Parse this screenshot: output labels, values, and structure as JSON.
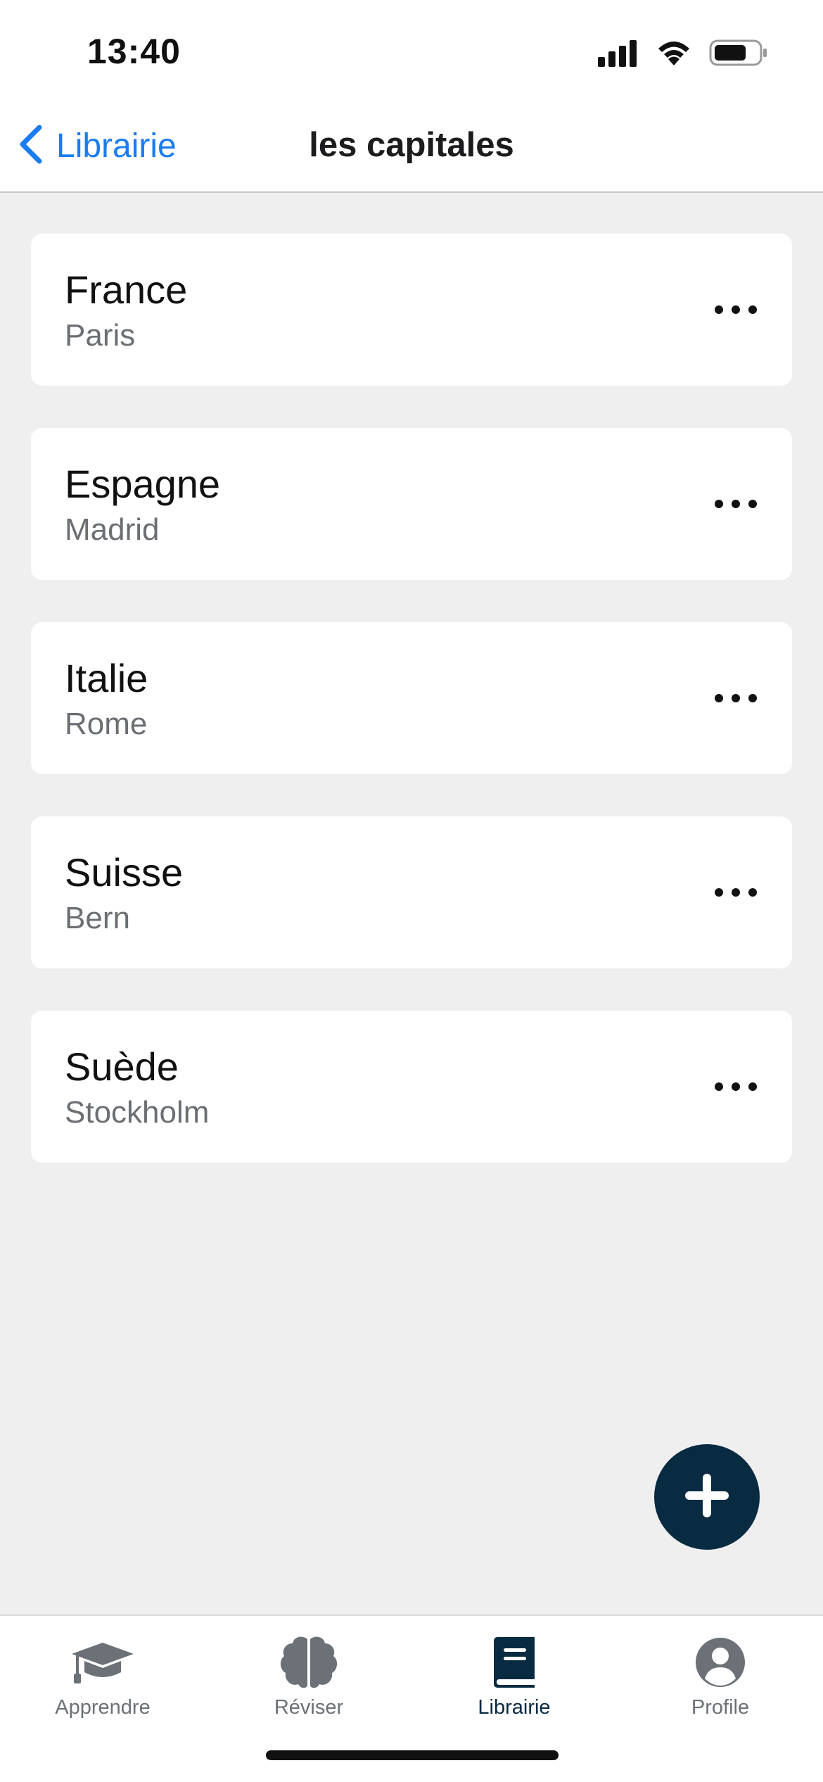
{
  "status_bar": {
    "time": "13:40"
  },
  "nav": {
    "back_label": "Librairie",
    "title": "les capitales"
  },
  "cards": [
    {
      "title": "France",
      "subtitle": "Paris"
    },
    {
      "title": "Espagne",
      "subtitle": "Madrid"
    },
    {
      "title": "Italie",
      "subtitle": "Rome"
    },
    {
      "title": "Suisse",
      "subtitle": "Bern"
    },
    {
      "title": "Suède",
      "subtitle": "Stockholm"
    }
  ],
  "tabs": [
    {
      "label": "Apprendre",
      "icon": "graduation-cap-icon",
      "active": false
    },
    {
      "label": "Réviser",
      "icon": "brain-icon",
      "active": false
    },
    {
      "label": "Librairie",
      "icon": "book-icon",
      "active": true
    },
    {
      "label": "Profile",
      "icon": "user-circle-icon",
      "active": false
    }
  ],
  "colors": {
    "accent_blue": "#1a7cf0",
    "navy": "#082b42",
    "inactive_gray": "#6b7176",
    "background": "#efefef"
  }
}
